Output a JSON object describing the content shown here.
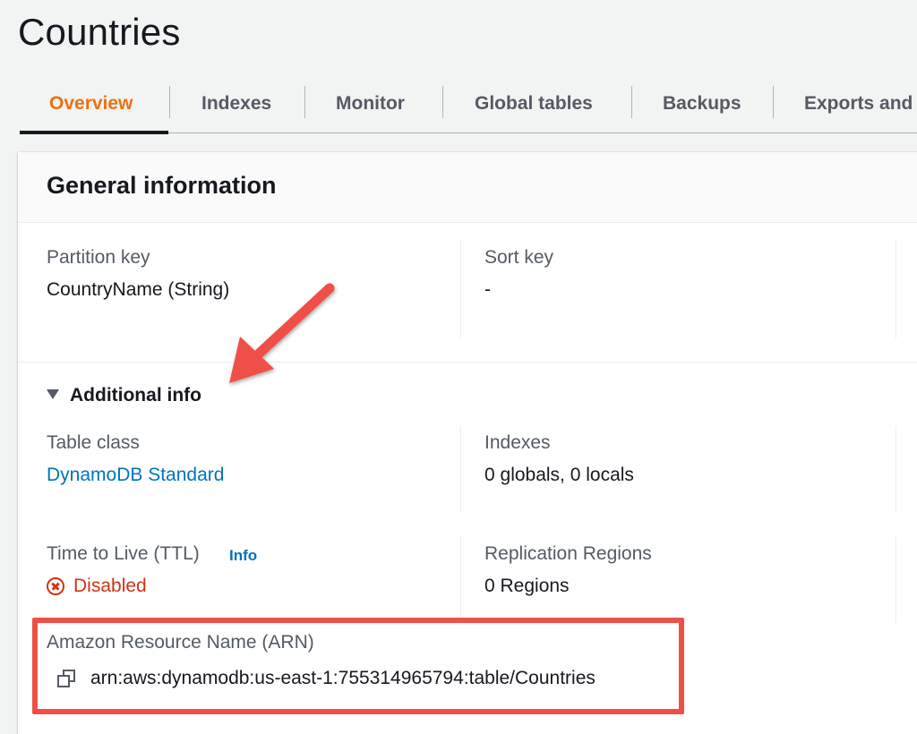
{
  "page": {
    "title": "Countries"
  },
  "tabs": [
    {
      "label": "Overview",
      "active": true
    },
    {
      "label": "Indexes"
    },
    {
      "label": "Monitor"
    },
    {
      "label": "Global tables"
    },
    {
      "label": "Backups"
    },
    {
      "label": "Exports and"
    }
  ],
  "general_info": {
    "title": "General information",
    "partition_key": {
      "label": "Partition key",
      "value": "CountryName (String)"
    },
    "sort_key": {
      "label": "Sort key",
      "value": "-"
    },
    "additional_info": {
      "toggle_label": "Additional info",
      "expanded": true,
      "table_class": {
        "label": "Table class",
        "value": "DynamoDB Standard"
      },
      "indexes": {
        "label": "Indexes",
        "value": "0 globals, 0 locals"
      },
      "ttl": {
        "label": "Time to Live (TTL)",
        "info_label": "Info",
        "status": "Disabled"
      },
      "replication": {
        "label": "Replication Regions",
        "value": "0 Regions"
      },
      "arn": {
        "label": "Amazon Resource Name (ARN)",
        "value": "arn:aws:dynamodb:us-east-1:755314965794:table/Countries"
      }
    }
  },
  "colors": {
    "accent_tab": "#ec7211",
    "link": "#0073bb",
    "error": "#d13212",
    "annotation": "#ef5046"
  },
  "icons": {
    "copy": "copy-icon",
    "error": "error-circle-icon",
    "caret": "caret-down-icon"
  }
}
